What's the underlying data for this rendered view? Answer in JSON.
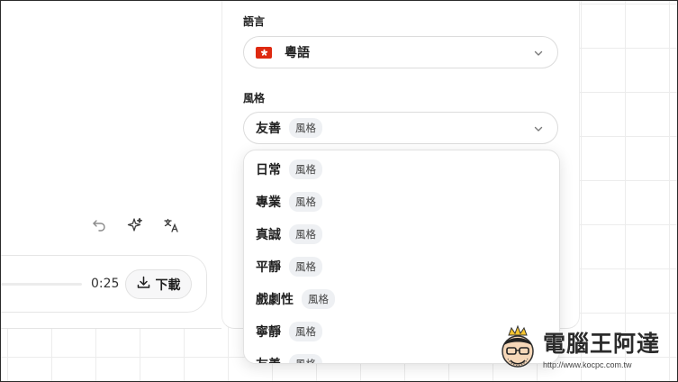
{
  "player": {
    "time": "0:25",
    "download_label": "下載",
    "progress": 1.0
  },
  "toolbar": {
    "icons": [
      "undo-icon",
      "sparkle-icon",
      "translate-icon"
    ]
  },
  "language": {
    "label": "語言",
    "selected": "粵語",
    "flag": "hong-kong-flag"
  },
  "style": {
    "label": "風格",
    "selected": "友善",
    "selected_tag": "風格",
    "options": [
      {
        "name": "日常",
        "tag": "風格"
      },
      {
        "name": "專業",
        "tag": "風格"
      },
      {
        "name": "真誠",
        "tag": "風格"
      },
      {
        "name": "平靜",
        "tag": "風格"
      },
      {
        "name": "戲劇性",
        "tag": "風格"
      },
      {
        "name": "寧靜",
        "tag": "風格"
      },
      {
        "name": "友善",
        "tag": "風格"
      }
    ]
  },
  "watermark": {
    "title": "電腦王阿達",
    "url": "http://www.kocpc.com.tw"
  },
  "colors": {
    "accent_flag": "#de2910",
    "chip_bg": "#eef0f3"
  }
}
